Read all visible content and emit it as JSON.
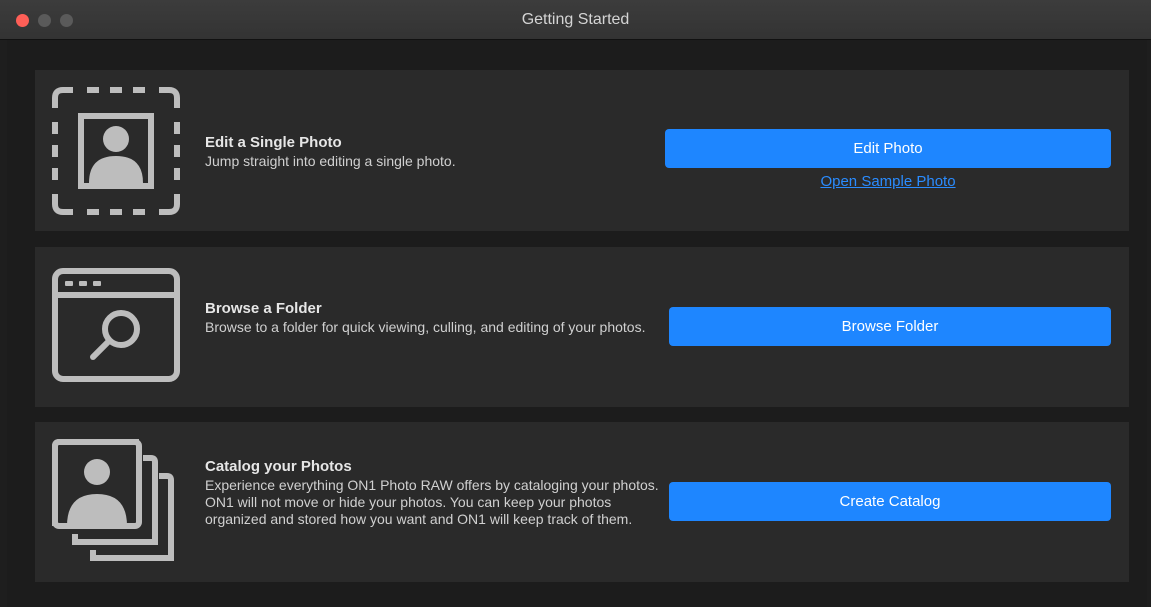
{
  "window": {
    "title": "Getting Started"
  },
  "sections": [
    {
      "heading": "Edit a Single Photo",
      "description": "Jump straight into editing a single photo.",
      "button_label": "Edit Photo",
      "link_label": "Open Sample Photo",
      "icon": "photo-frame-icon"
    },
    {
      "heading": "Browse a Folder",
      "description": "Browse to a folder for quick viewing, culling, and editing of your photos.",
      "button_label": "Browse Folder",
      "icon": "browser-search-icon"
    },
    {
      "heading": "Catalog your Photos",
      "description": "Experience everything ON1 Photo RAW offers by cataloging your photos. ON1 will not move or hide your photos. You can keep your photos organized and stored how you want and ON1 will keep track of them.",
      "button_label": "Create Catalog",
      "icon": "photo-stack-icon"
    }
  ],
  "colors": {
    "accent": "#1e86ff",
    "link": "#2a8cff",
    "close_button": "#fe5f57",
    "panel_background": "#2a2a2a",
    "window_background": "#1c1c1c"
  }
}
